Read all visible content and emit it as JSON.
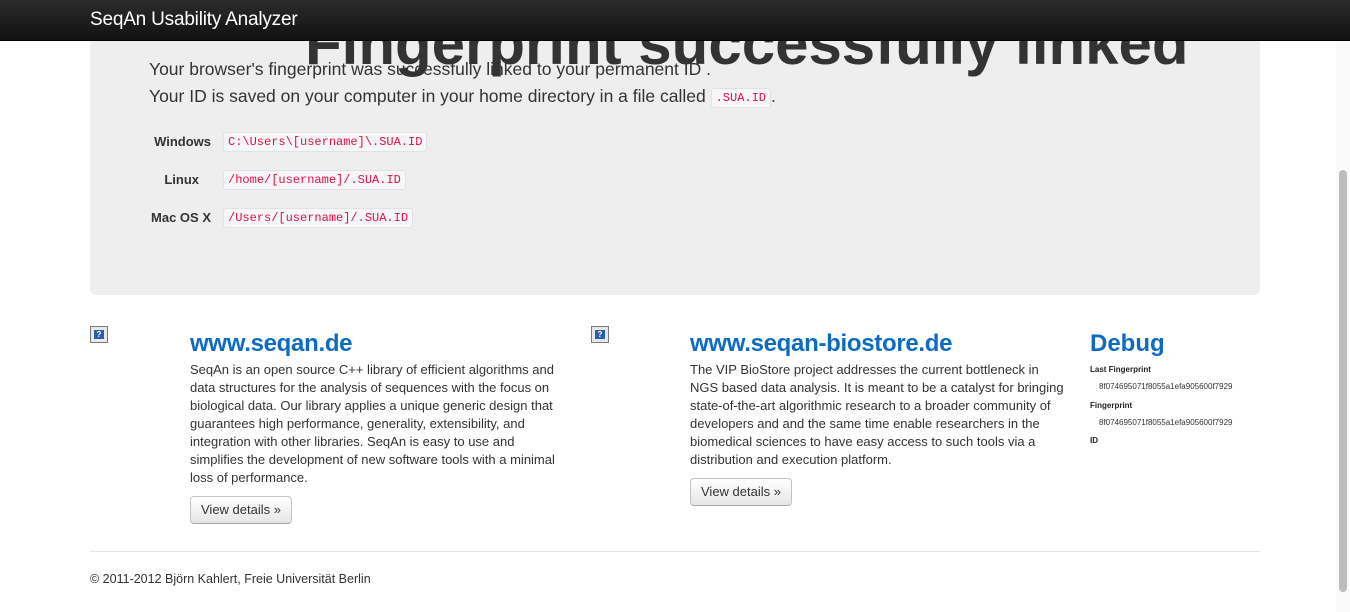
{
  "navbar": {
    "brand": "SeqAn Usability Analyzer"
  },
  "hero": {
    "title_fragment": "Fingerprint successfully linked",
    "line1": "Your browser's fingerprint was successfully linked to your permanent ID .",
    "line2_prefix": "Your ID is saved on your computer in your home directory in a file called",
    "line2_code": ".SUA.ID",
    "line2_suffix": ".",
    "paths": [
      {
        "os": "Windows",
        "path": "C:\\Users\\[username]\\.SUA.ID"
      },
      {
        "os": "Linux",
        "path": "/home/[username]/.SUA.ID"
      },
      {
        "os": "Mac OS X",
        "path": "/Users/[username]/.SUA.ID"
      }
    ]
  },
  "columns": [
    {
      "title": "www.seqan.de",
      "description": "SeqAn is an open source C++ library of efficient algorithms and data structures for the analysis of sequences with the focus on biological data. Our library applies a unique generic design that guarantees high performance, generality, extensibility, and integration with other libraries. SeqAn is easy to use and simplifies the development of new software tools with a minimal loss of performance.",
      "button": "View details »",
      "icon": "broken-image-icon"
    },
    {
      "title": "www.seqan-biostore.de",
      "description": "The VIP BioStore project addresses the current bottleneck in NGS based data analysis. It is meant to be a catalyst for bringing state-of-the-art algorithmic research to a broader community of developers and and the same time enable researchers in the biomedical sciences to have easy access to such tools via a distribution and execution platform.",
      "button": "View details »",
      "icon": "broken-image-icon"
    }
  ],
  "debug": {
    "title": "Debug",
    "last_fingerprint_label": "Last Fingerprint",
    "last_fingerprint_value": "8f074695071f8055a1efa905600f7929",
    "fingerprint_label": "Fingerprint",
    "fingerprint_value": "8f074695071f8055a1efa905600f7929",
    "id_label": "ID"
  },
  "footer": {
    "text": "© 2011-2012 Björn Kahlert, Freie Universität Berlin"
  },
  "colors": {
    "link_blue": "#0d6bc2",
    "code_red": "#dd1144",
    "hero_bg": "#eeeeee",
    "navbar_bg": "#1b1b1b"
  }
}
